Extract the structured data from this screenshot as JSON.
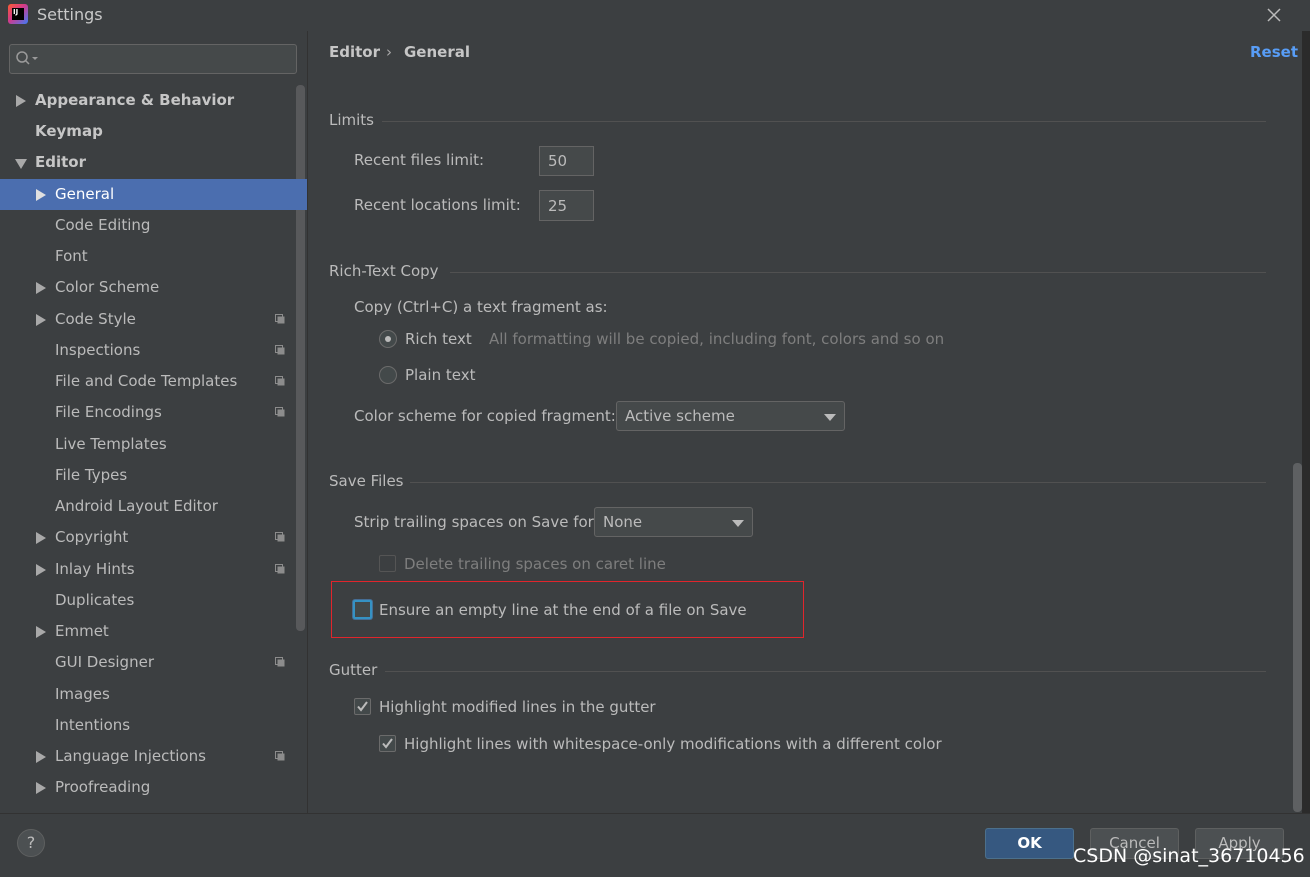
{
  "window": {
    "title": "Settings"
  },
  "sidebar": {
    "search": {
      "value": "",
      "placeholder": ""
    },
    "items": [
      {
        "label": "Appearance & Behavior"
      },
      {
        "label": "Keymap"
      },
      {
        "label": "Editor"
      },
      {
        "label": "General"
      },
      {
        "label": "Code Editing"
      },
      {
        "label": "Font"
      },
      {
        "label": "Color Scheme"
      },
      {
        "label": "Code Style"
      },
      {
        "label": "Inspections"
      },
      {
        "label": "File and Code Templates"
      },
      {
        "label": "File Encodings"
      },
      {
        "label": "Live Templates"
      },
      {
        "label": "File Types"
      },
      {
        "label": "Android Layout Editor"
      },
      {
        "label": "Copyright"
      },
      {
        "label": "Inlay Hints"
      },
      {
        "label": "Duplicates"
      },
      {
        "label": "Emmet"
      },
      {
        "label": "GUI Designer"
      },
      {
        "label": "Images"
      },
      {
        "label": "Intentions"
      },
      {
        "label": "Language Injections"
      },
      {
        "label": "Proofreading"
      }
    ]
  },
  "header": {
    "breadcrumb": [
      "Editor",
      "General"
    ],
    "separator": "›",
    "reset_label": "Reset"
  },
  "limits": {
    "title": "Limits",
    "recent_files_label": "Recent files limit:",
    "recent_files_value": "50",
    "recent_locations_label": "Recent locations limit:",
    "recent_locations_value": "25"
  },
  "rich_text": {
    "title": "Rich-Text Copy",
    "copy_label": "Copy (Ctrl+C) a text fragment as:",
    "rich_label": "Rich text",
    "rich_hint": "All formatting will be copied, including font, colors and so on",
    "plain_label": "Plain text",
    "scheme_label": "Color scheme for copied fragment:",
    "scheme_value": "Active scheme"
  },
  "save_files": {
    "title": "Save Files",
    "strip_label": "Strip trailing spaces on Save for:",
    "strip_value": "None",
    "delete_trailing_label": "Delete trailing spaces on caret line",
    "ensure_empty_line_label": "Ensure an empty line at the end of a file on Save"
  },
  "gutter": {
    "title": "Gutter",
    "highlight_modified_label": "Highlight modified lines in the gutter",
    "highlight_whitespace_label": "Highlight lines with whitespace-only modifications with a different color"
  },
  "buttons": {
    "ok": "OK",
    "cancel": "Cancel",
    "apply": "Apply",
    "help": "?"
  },
  "watermark": "CSDN @sinat_36710456",
  "colors": {
    "background": "#3c3f41",
    "selection": "#4b6eaf",
    "link": "#589df6",
    "primary_button": "#365880",
    "highlight_border": "#e0252c"
  }
}
